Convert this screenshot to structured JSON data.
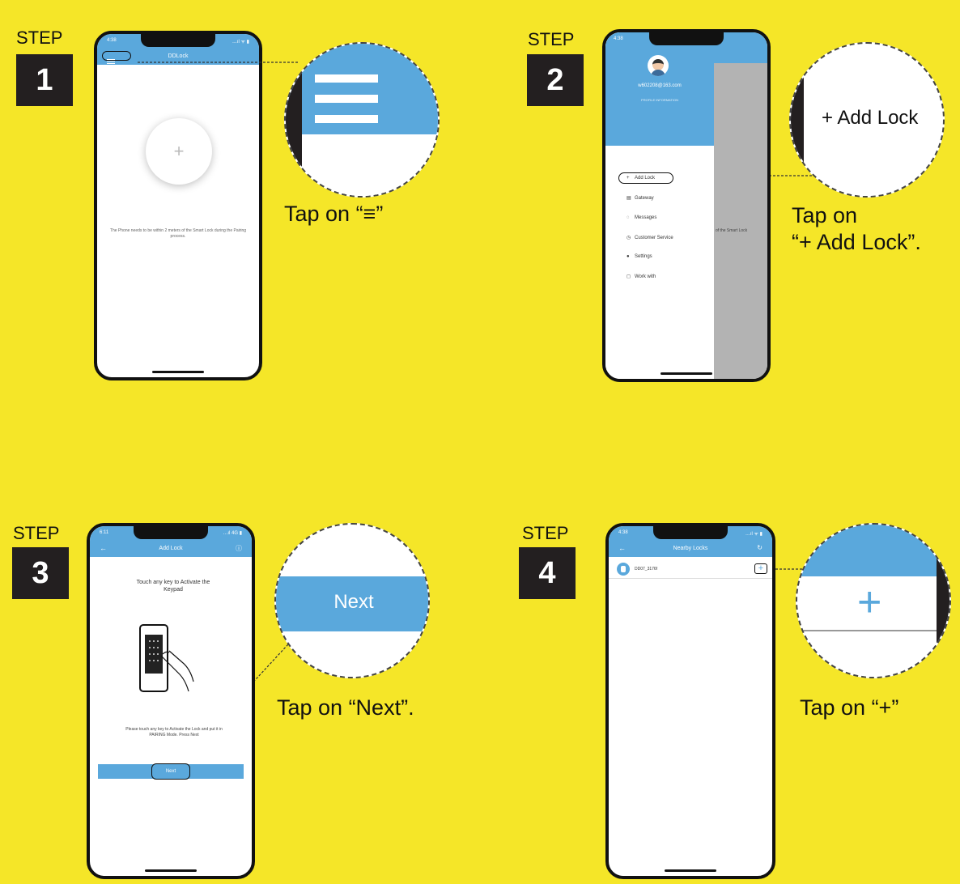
{
  "steps": [
    {
      "label": "STEP",
      "number": "1",
      "caption": "Tap on “≡”",
      "phone": {
        "time": "4:38",
        "status": "…ıl ᯤ ▮",
        "title": "DDLock",
        "message": "The Phone needs to be within 2 meters of the Smart Lock during the Pairing process."
      }
    },
    {
      "label": "STEP",
      "number": "2",
      "caption_line1": "Tap on",
      "caption_line2": "“+ Add Lock”.",
      "zoom_text": "+ Add Lock",
      "phone": {
        "time": "4:38",
        "status": "…ıl ᯤ ▮",
        "email": "w602208@163.com",
        "subtitle": "PROFILE INFORMATION",
        "overlay_text": "of the Smart Lock",
        "menu": [
          {
            "icon": "+",
            "label": "Add Lock"
          },
          {
            "icon": "▤",
            "label": "Gateway"
          },
          {
            "icon": "◌",
            "label": "Messages"
          },
          {
            "icon": "◷",
            "label": "Customer Service"
          },
          {
            "icon": "●",
            "label": "Settings"
          },
          {
            "icon": "◻",
            "label": "Work with"
          }
        ]
      }
    },
    {
      "label": "STEP",
      "number": "3",
      "caption": "Tap on “Next”.",
      "zoom_text": "Next",
      "phone": {
        "time": "6:11",
        "status": "…ıl 4G ▮",
        "title": "Add Lock",
        "heading": "Touch any key to Activate the Keypad",
        "instruction": "Please touch any key to Activate the Lock and put it in PAIRING Mode. Press Next",
        "button": "Next"
      }
    },
    {
      "label": "STEP",
      "number": "4",
      "caption": "Tap on “+”",
      "phone": {
        "time": "4:38",
        "status": "…ıl ᯤ ▮",
        "title": "Nearby Locks",
        "device": "DD07_3176f"
      }
    }
  ],
  "colors": {
    "background": "#f5e628",
    "accent": "#5aa8dc",
    "dark": "#231f20"
  }
}
